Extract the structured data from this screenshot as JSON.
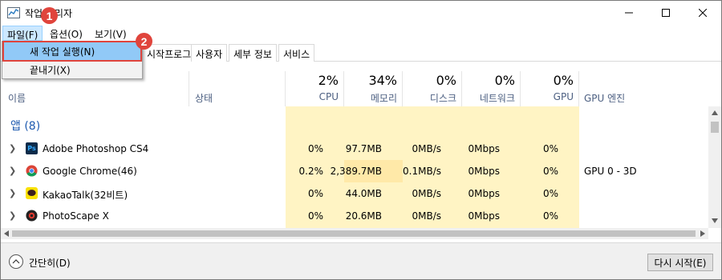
{
  "window": {
    "title": "작업 관리자"
  },
  "menu": {
    "file": "파일(F)",
    "options": "옵션(O)",
    "view": "보기(V)"
  },
  "file_menu": {
    "new_task": "새 작업 실행(N)",
    "exit": "끝내기(X)"
  },
  "badges": {
    "one": "1",
    "two": "2"
  },
  "tabs": [
    "시작프로그램",
    "사용자",
    "세부 정보",
    "서비스"
  ],
  "header": {
    "name": "이름",
    "status": "상태",
    "cpu_pct": "2%",
    "cpu": "CPU",
    "mem_pct": "34%",
    "mem": "메모리",
    "disk_pct": "0%",
    "disk": "디스크",
    "net_pct": "0%",
    "net": "네트워크",
    "gpu_pct": "0%",
    "gpu": "GPU",
    "gpu_engine": "GPU 엔진"
  },
  "group": {
    "label": "앱 (8)"
  },
  "rows": [
    {
      "name": "Adobe Photoshop CS4",
      "cpu": "0%",
      "mem": "97.7MB",
      "disk": "0MB/s",
      "net": "0Mbps",
      "gpu": "0%",
      "engine": "",
      "icon": "photoshop-icon"
    },
    {
      "name": "Google Chrome(46)",
      "cpu": "0.2%",
      "mem": "2,389.7MB",
      "disk": "0.1MB/s",
      "net": "0Mbps",
      "gpu": "0%",
      "engine": "GPU 0 - 3D",
      "icon": "chrome-icon"
    },
    {
      "name": "KakaoTalk(32비트)",
      "cpu": "0%",
      "mem": "44.0MB",
      "disk": "0MB/s",
      "net": "0Mbps",
      "gpu": "0%",
      "engine": "",
      "icon": "kakaotalk-icon"
    },
    {
      "name": "PhotoScape X",
      "cpu": "0%",
      "mem": "20.6MB",
      "disk": "0MB/s",
      "net": "0Mbps",
      "gpu": "0%",
      "engine": "",
      "icon": "photoscape-icon"
    }
  ],
  "footer": {
    "fewer_details": "간단히(D)",
    "restart": "다시 시작(E)"
  },
  "colors": {
    "accent_red": "#e0443c",
    "heat_light": "#fff4c4",
    "heat_mid": "#ffe9a8",
    "selection": "#91c9f7"
  }
}
